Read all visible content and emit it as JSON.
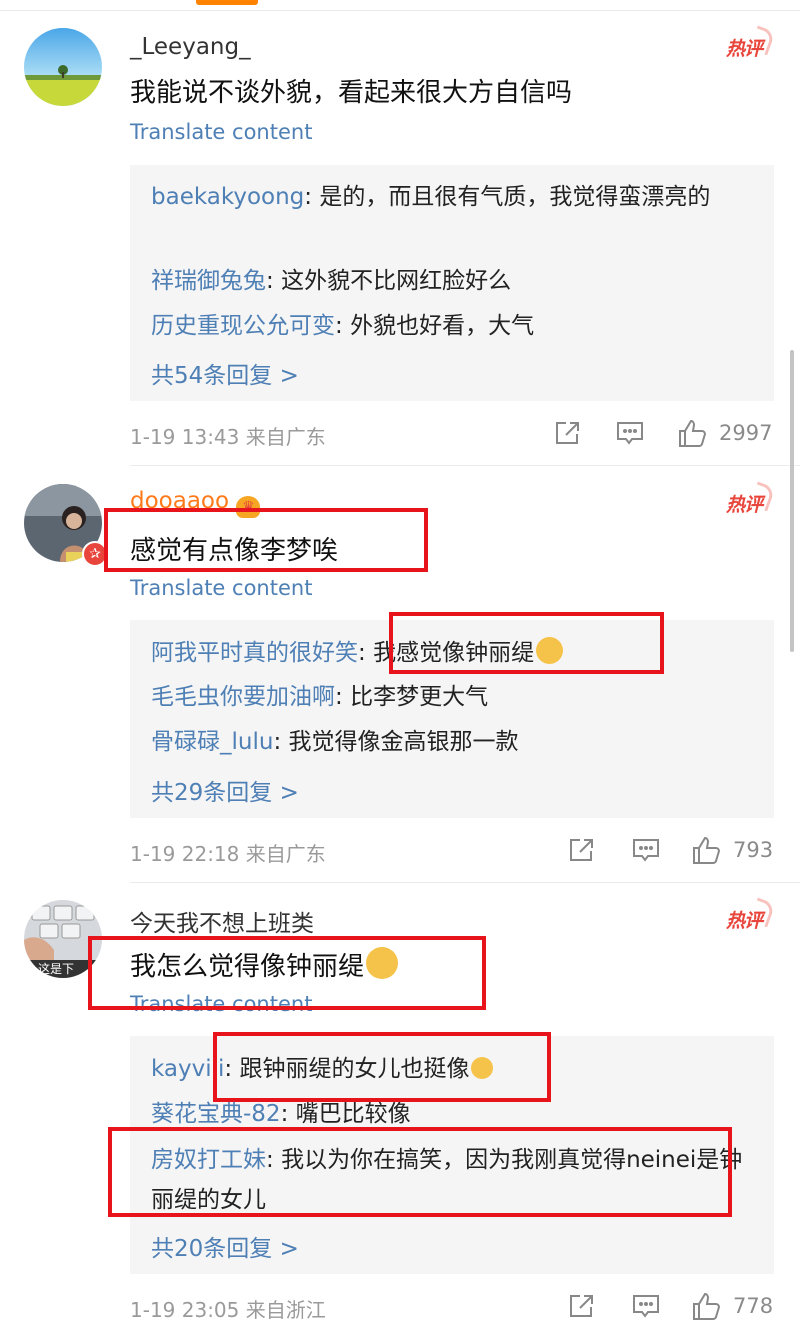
{
  "colors": {
    "link": "#4e7fb5",
    "accent": "#ff8200",
    "hot": "#e8463c",
    "highlight_box": "#e8141c"
  },
  "comments": [
    {
      "username": "_Leeyang_",
      "hot_label": "热评",
      "text": "我能说不谈外貌，看起来很大方自信吗",
      "translate": "Translate content",
      "replies": [
        {
          "name": "baekakyoong",
          "sep": ": ",
          "text": "是的，而且很有气质，我觉得蛮漂亮的"
        },
        {
          "name": "祥瑞御兔兔",
          "sep": ": ",
          "text": "这外貌不比网红脸好么"
        },
        {
          "name": "历史重现公允可变",
          "sep": ": ",
          "text": "外貌也好看，大气"
        }
      ],
      "more": "共54条回复 >",
      "time": "1-19 13:43 来自广东",
      "likes": "2997",
      "avatar_icon": "landscape-avatar"
    },
    {
      "username": "dooaaoo",
      "hot_label": "热评",
      "text": "感觉有点像李梦唉",
      "translate": "Translate content",
      "replies": [
        {
          "name": "阿我平时真的很好笑",
          "sep": ": ",
          "text": "我感觉像钟丽缇"
        },
        {
          "name": "毛毛虫你要加油啊",
          "sep": ": ",
          "text": "比李梦更大气"
        },
        {
          "name": "骨碌碌_lulu",
          "sep": ": ",
          "text": "我觉得像金高银那一款"
        }
      ],
      "more": "共29条回复 >",
      "time": "1-19 22:18 来自广东",
      "likes": "793",
      "avatar_icon": "portrait-avatar",
      "badge_icon": "verified-badge-icon",
      "crown_icon": "crown-icon"
    },
    {
      "username": "今天我不想上班类",
      "hot_label": "热评",
      "text": "我怎么觉得像钟丽缇",
      "translate": "Translate content",
      "replies": [
        {
          "name": "kayvili",
          "sep": ": ",
          "text": "跟钟丽缇的女儿也挺像"
        },
        {
          "name": "葵花宝典-82",
          "sep": ": ",
          "text": "嘴巴比较像"
        },
        {
          "name": "房奴打工妹",
          "sep": ": ",
          "text": "我以为你在搞笑，因为我刚真觉得neinei是钟丽缇的女儿"
        }
      ],
      "more": "共20条回复 >",
      "time": "1-19 23:05 来自浙江",
      "likes": "778",
      "avatar_icon": "keyboard-avatar",
      "avatar_caption": "这是下"
    }
  ]
}
